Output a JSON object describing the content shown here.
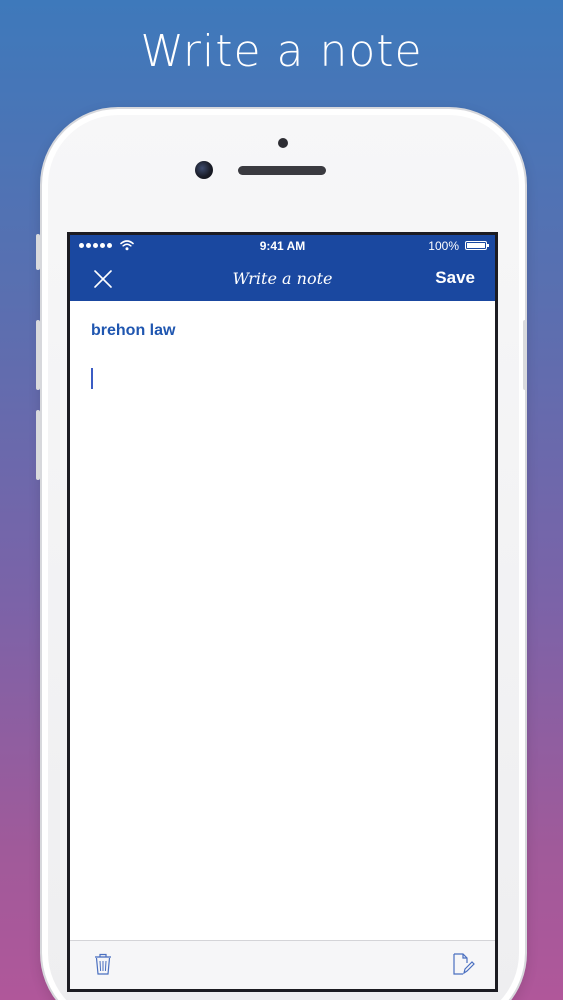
{
  "headline": "Write a note",
  "status_bar": {
    "time": "9:41 AM",
    "battery_percent": "100%",
    "battery_level": 1.0,
    "signal_icon": "signal-dots-icon",
    "wifi_icon": "wifi-icon"
  },
  "nav_bar": {
    "close_icon": "close-icon",
    "title": "Write a note",
    "save_label": "Save"
  },
  "note": {
    "title": "brehon law",
    "body": ""
  },
  "toolbar": {
    "delete_icon": "trash-icon",
    "compose_icon": "compose-icon"
  },
  "colors": {
    "nav_background": "#1a48a0",
    "note_title": "#1f56b0",
    "cursor": "#3b5cc4",
    "background_top": "#3e79bb",
    "background_bottom": "#b0579a"
  }
}
